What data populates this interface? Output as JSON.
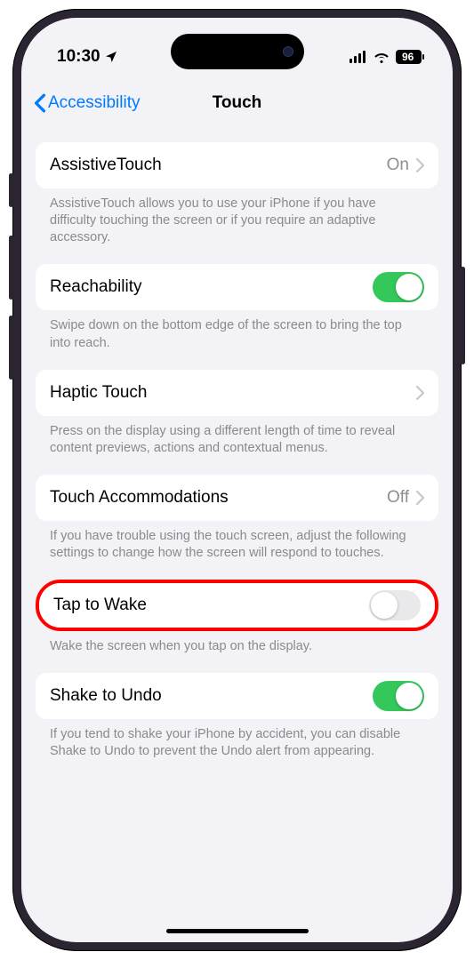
{
  "status": {
    "time": "10:30",
    "battery": "96"
  },
  "nav": {
    "back": "Accessibility",
    "title": "Touch"
  },
  "rows": {
    "assistive": {
      "label": "AssistiveTouch",
      "value": "On"
    },
    "assistive_footer": "AssistiveTouch allows you to use your iPhone if you have difficulty touching the screen or if you require an adaptive accessory.",
    "reachability": {
      "label": "Reachability"
    },
    "reachability_footer": "Swipe down on the bottom edge of the screen to bring the top into reach.",
    "haptic": {
      "label": "Haptic Touch"
    },
    "haptic_footer": "Press on the display using a different length of time to reveal content previews, actions and contextual menus.",
    "accommodations": {
      "label": "Touch Accommodations",
      "value": "Off"
    },
    "accommodations_footer": "If you have trouble using the touch screen, adjust the following settings to change how the screen will respond to touches.",
    "tapwake": {
      "label": "Tap to Wake"
    },
    "tapwake_footer": "Wake the screen when you tap on the display.",
    "shake": {
      "label": "Shake to Undo"
    },
    "shake_footer": "If you tend to shake your iPhone by accident, you can disable Shake to Undo to prevent the Undo alert from appearing."
  }
}
